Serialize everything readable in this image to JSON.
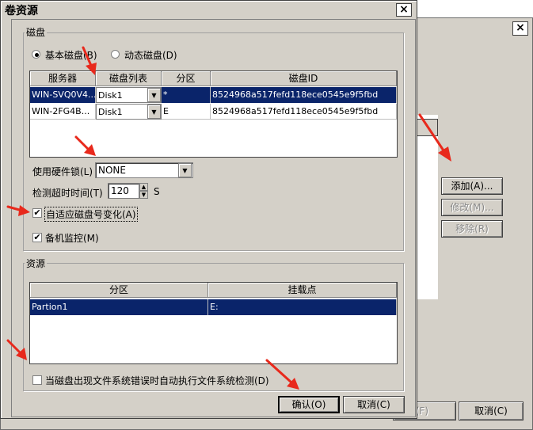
{
  "background_window": {
    "close_glyph": "×",
    "buttons": {
      "add": "添加(A)...",
      "modify": "修改(M)...",
      "remove": "移除(R)",
      "cancel": "取消(C)",
      "partial": "(F)"
    }
  },
  "dialog": {
    "title": "卷资源",
    "close_glyph": "×",
    "disk_group": {
      "legend": "磁盘",
      "radio_basic": "基本磁盘(B)",
      "radio_dynamic": "动态磁盘(D)",
      "selected_radio": "basic",
      "table": {
        "headers": [
          "服务器",
          "磁盘列表",
          "分区",
          "磁盘ID"
        ],
        "rows": [
          {
            "server": "WIN-SVQ0V4...",
            "disk": "Disk1",
            "partition": "*",
            "disk_id": "8524968a517fefd118ece0545e9f5fbd",
            "selected": true
          },
          {
            "server": "WIN-2FG4B...",
            "disk": "Disk1",
            "partition": "E",
            "disk_id": "8524968a517fefd118ece0545e9f5fbd",
            "selected": false
          }
        ]
      },
      "hw_lock_label": "使用硬件锁(L)",
      "hw_lock_value": "NONE",
      "timeout_label": "检测超时时间(T)",
      "timeout_value": "120",
      "timeout_unit": "S",
      "adapt_label": "自适应磁盘号变化(A)",
      "adapt_checked": true,
      "monitor_label": "备机监控(M)",
      "monitor_checked": true
    },
    "resource_group": {
      "legend": "资源",
      "table": {
        "headers": [
          "分区",
          "挂载点"
        ],
        "rows": [
          {
            "partition": "Partion1",
            "mount": "E:",
            "selected": true
          }
        ]
      },
      "fs_check_label": "当磁盘出现文件系统错误时自动执行文件系统检测(D)",
      "fs_check_checked": false
    },
    "buttons": {
      "ok": "确认(O)",
      "cancel": "取消(C)"
    }
  },
  "colors": {
    "selection": "#0a246a",
    "face": "#d4d0c8",
    "annotation_arrow": "#e8291c"
  },
  "icons": {
    "dropdown": "▼",
    "spin_up": "▲",
    "spin_down": "▼",
    "check": "✔"
  }
}
